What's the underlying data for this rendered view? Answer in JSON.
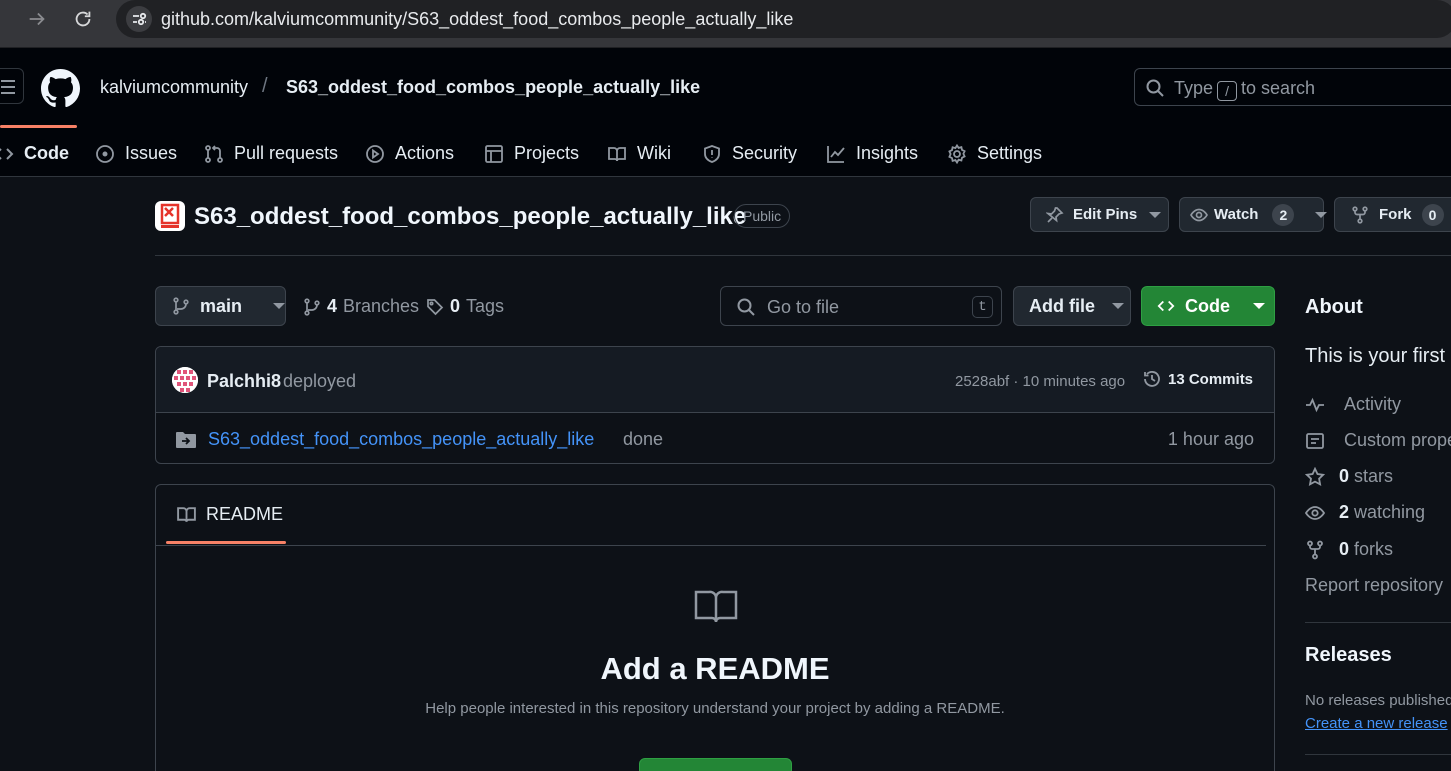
{
  "browser": {
    "url": "github.com/kalviumcommunity/S63_oddest_food_combos_people_actually_like"
  },
  "header": {
    "owner": "kalviumcommunity",
    "separator": "/",
    "repo": "S63_oddest_food_combos_people_actually_like",
    "search": {
      "prefix": "Type",
      "key": "/",
      "suffix": "to search"
    }
  },
  "tabs": [
    {
      "label": "Code",
      "icon": "code-icon",
      "selected": true
    },
    {
      "label": "Issues",
      "icon": "issue-icon"
    },
    {
      "label": "Pull requests",
      "icon": "pull-request-icon"
    },
    {
      "label": "Actions",
      "icon": "play-icon"
    },
    {
      "label": "Projects",
      "icon": "table-icon"
    },
    {
      "label": "Wiki",
      "icon": "book-icon"
    },
    {
      "label": "Security",
      "icon": "shield-icon"
    },
    {
      "label": "Insights",
      "icon": "graph-icon"
    },
    {
      "label": "Settings",
      "icon": "gear-icon"
    }
  ],
  "repo_head": {
    "title": "S63_oddest_food_combos_people_actually_like",
    "visibility": "Public",
    "edit_pins": "Edit Pins",
    "watch": {
      "label": "Watch",
      "count": "2"
    },
    "fork": {
      "label": "Fork",
      "count": "0"
    }
  },
  "file_nav": {
    "branch": "main",
    "branches": {
      "count": "4",
      "label": "Branches"
    },
    "tags": {
      "count": "0",
      "label": "Tags"
    },
    "goto_placeholder": "Go to file",
    "goto_key": "t",
    "add_file": "Add file",
    "code": "Code"
  },
  "latest_commit": {
    "author": "Palchhi8",
    "message": "deployed",
    "hash_time": "2528abf · 10 minutes ago",
    "commits": "13 Commits"
  },
  "files": [
    {
      "name": "S63_oddest_food_combos_people_actually_like",
      "message": "done",
      "time": "1 hour ago",
      "icon": "folder-icon"
    }
  ],
  "readme": {
    "tab": "README",
    "heading": "Add a README",
    "description": "Help people interested in this repository understand your project by adding a README."
  },
  "about": {
    "title": "About",
    "description": "This is your first r",
    "items": [
      {
        "icon": "pulse-icon",
        "count": "",
        "label": "Activity"
      },
      {
        "icon": "note-icon",
        "count": "",
        "label": "Custom prope"
      },
      {
        "icon": "star-icon",
        "count": "0",
        "label": "stars"
      },
      {
        "icon": "eye-icon",
        "count": "2",
        "label": "watching"
      },
      {
        "icon": "fork-icon",
        "count": "0",
        "label": "forks"
      }
    ],
    "report": "Report repository"
  },
  "releases": {
    "title": "Releases",
    "none": "No releases published",
    "create": "Create a new release"
  },
  "colors": {
    "background": "#0d1117",
    "header": "#010409",
    "accent_green": "#238636",
    "link_blue": "#4493f8",
    "tab_underline": "#f78166"
  }
}
